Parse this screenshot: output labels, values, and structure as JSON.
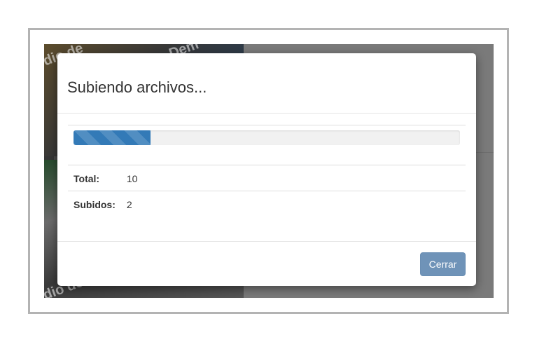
{
  "modal": {
    "title": "Subiendo archivos...",
    "progress_fraction": 0.2,
    "progress_color": "#337ab7",
    "stats": [
      {
        "label": "Total:",
        "value": "10"
      },
      {
        "label": "Subidos:",
        "value": "2"
      }
    ],
    "close_button": "Cerrar",
    "close_button_color": "#6f93b8"
  },
  "background": {
    "watermark_text": [
      "dio de",
      "Dem",
      "dio de"
    ]
  }
}
